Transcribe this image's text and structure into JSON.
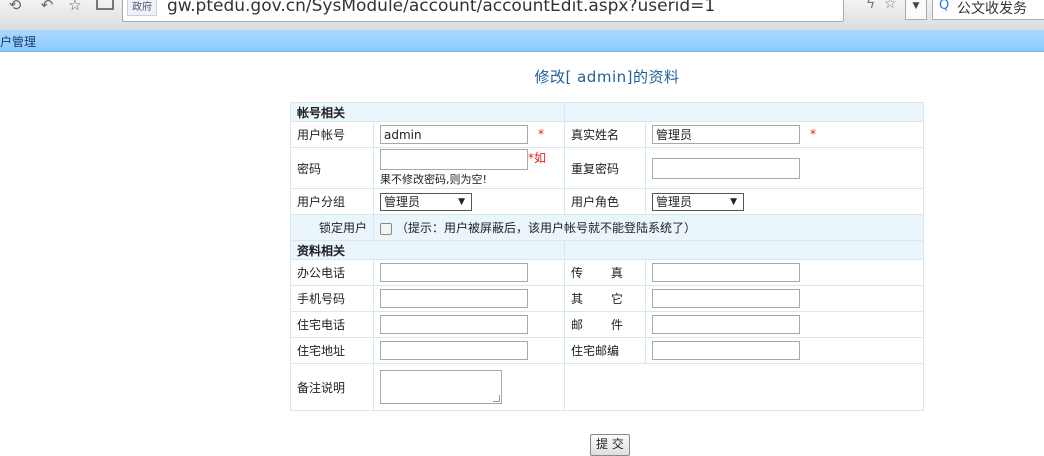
{
  "browser": {
    "url_badge": "政府",
    "url": "gw.ptedu.gov.cn/SysModule/account/accountEdit.aspx?userid=1",
    "search_text": "公文收发务"
  },
  "module": {
    "title": "用户管理"
  },
  "page": {
    "title": "修改[ admin]的资料"
  },
  "form": {
    "section_account": "帐号相关",
    "section_profile": "资料相关",
    "account_label": "用户帐号",
    "account_value": "admin",
    "realname_label": "真实姓名",
    "realname_value": "管理员",
    "required_mark": "*",
    "password_label": "密码",
    "password_hint_a": "*如",
    "password_hint_b": "果不修改密码,则为空!",
    "repeat_password_label": "重复密码",
    "group_label": "用户分组",
    "group_value": "管理员",
    "role_label": "用户角色",
    "role_value": "管理员",
    "lock_label": "锁定用户",
    "lock_hint": "（提示：用户被屏蔽后，该用户帐号就不能登陆系统了）",
    "office_phone_label": "办公电话",
    "fax_label": "传 真",
    "mobile_label": "手机号码",
    "other_label": "其 它",
    "home_phone_label": "住宅电话",
    "email_label": "邮 件",
    "home_address_label": "住宅地址",
    "zip_label": "住宅邮编",
    "notes_label": "备注说明"
  },
  "submit_label": "提 交"
}
